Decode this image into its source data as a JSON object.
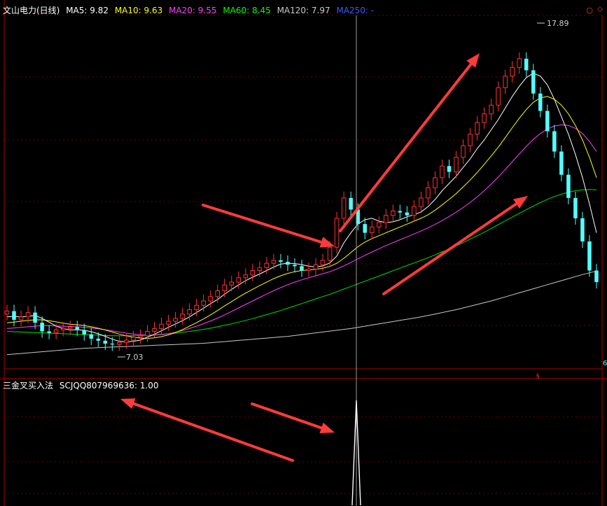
{
  "header": {
    "title": "文山电力(日线)",
    "ma_items": [
      {
        "label": "MA5: 9.82",
        "color": "#ffffff"
      },
      {
        "label": "MA10: 9.63",
        "color": "#ffff00"
      },
      {
        "label": "MA20: 9.55",
        "color": "#ff40ff"
      },
      {
        "label": "MA60: 8.45",
        "color": "#00ff00"
      },
      {
        "label": "MA120: 7.97",
        "color": "#c8c8c8"
      },
      {
        "label": "MA250: -",
        "color": "#3c5aff"
      }
    ],
    "close_symbol": "○",
    "diamond_symbol": "◇"
  },
  "indicator": {
    "title": "三金叉买入法",
    "value_text": "SCJQQ807969636: 1.00"
  },
  "annotations": {
    "high_label": "17.89",
    "low_label": "7.03",
    "edge_label": "6"
  },
  "colors": {
    "up": "#ff3232",
    "down": "#54ffff",
    "ma5": "#ffffff",
    "ma10": "#ffff00",
    "ma20": "#ff40ff",
    "ma60": "#00dd00",
    "ma120": "#c8c8c8",
    "axis": "#b00000",
    "arrow": "#ff3b3b"
  },
  "chart_data": [
    {
      "type": "candlestick",
      "y_range": [
        6.6,
        18.3
      ],
      "candles_open": [
        8.2,
        8.3,
        8.0,
        8.1,
        8.25,
        7.9,
        7.6,
        7.55,
        7.65,
        7.7,
        7.75,
        7.65,
        7.5,
        7.35,
        7.28,
        7.18,
        7.15,
        7.22,
        7.3,
        7.4,
        7.45,
        7.6,
        7.7,
        7.85,
        7.95,
        8.05,
        8.2,
        8.35,
        8.5,
        8.65,
        8.8,
        9.0,
        9.2,
        9.3,
        9.45,
        9.55,
        9.7,
        9.8,
        9.95,
        10.05,
        10.0,
        9.9,
        9.85,
        9.7,
        9.75,
        9.9,
        10.05,
        10.5,
        11.5,
        12.2,
        11.8,
        11.3,
        11.0,
        11.2,
        11.35,
        11.6,
        11.75,
        11.7,
        11.6,
        11.9,
        12.2,
        12.55,
        12.9,
        13.3,
        13.1,
        13.6,
        14.0,
        14.4,
        14.8,
        15.1,
        15.4,
        16.0,
        16.4,
        16.7,
        17.0,
        16.6,
        15.8,
        15.2,
        14.5,
        13.8,
        13.0,
        12.2,
        11.5,
        10.7,
        9.7
      ],
      "candles_close": [
        8.3,
        8.0,
        8.1,
        8.25,
        7.9,
        7.6,
        7.55,
        7.65,
        7.7,
        7.75,
        7.65,
        7.5,
        7.35,
        7.28,
        7.18,
        7.15,
        7.22,
        7.3,
        7.4,
        7.45,
        7.6,
        7.7,
        7.85,
        7.95,
        8.05,
        8.2,
        8.35,
        8.5,
        8.65,
        8.8,
        9.0,
        9.2,
        9.3,
        9.45,
        9.55,
        9.7,
        9.8,
        9.95,
        10.05,
        10.0,
        9.9,
        9.85,
        9.7,
        9.75,
        9.9,
        10.05,
        10.5,
        11.5,
        12.2,
        11.8,
        11.3,
        11.0,
        11.2,
        11.35,
        11.6,
        11.75,
        11.7,
        11.6,
        11.9,
        12.2,
        12.55,
        12.9,
        13.3,
        13.1,
        13.6,
        14.0,
        14.4,
        14.8,
        15.1,
        15.4,
        16.0,
        16.4,
        16.7,
        17.0,
        16.6,
        15.8,
        15.2,
        14.5,
        13.8,
        13.0,
        12.2,
        11.5,
        10.7,
        9.7,
        9.3
      ],
      "ma5": [
        8.1,
        8.12,
        8.1,
        8.12,
        8.15,
        8.05,
        7.92,
        7.78,
        7.7,
        7.65,
        7.66,
        7.64,
        7.59,
        7.52,
        7.43,
        7.33,
        7.26,
        7.24,
        7.26,
        7.3,
        7.4,
        7.5,
        7.62,
        7.74,
        7.86,
        7.97,
        8.1,
        8.25,
        8.4,
        8.56,
        8.7,
        8.88,
        9.05,
        9.2,
        9.35,
        9.47,
        9.58,
        9.7,
        9.82,
        9.92,
        9.95,
        9.94,
        9.9,
        9.85,
        9.82,
        9.86,
        9.96,
        10.2,
        10.65,
        11.0,
        11.3,
        11.45,
        11.5,
        11.4,
        11.35,
        11.38,
        11.45,
        11.55,
        11.62,
        11.72,
        11.9,
        12.15,
        12.45,
        12.7,
        12.95,
        13.25,
        13.55,
        13.9,
        14.2,
        14.55,
        14.9,
        15.3,
        15.7,
        16.05,
        16.35,
        16.5,
        16.4,
        16.1,
        15.6,
        15.0,
        14.4,
        13.7,
        12.9,
        12.0,
        11.0
      ],
      "ma10": [
        7.9,
        7.92,
        7.95,
        7.98,
        8.0,
        8.0,
        7.97,
        7.93,
        7.88,
        7.85,
        7.83,
        7.8,
        7.76,
        7.71,
        7.65,
        7.58,
        7.51,
        7.45,
        7.4,
        7.37,
        7.36,
        7.38,
        7.42,
        7.48,
        7.56,
        7.66,
        7.78,
        7.9,
        8.03,
        8.17,
        8.32,
        8.48,
        8.63,
        8.78,
        8.92,
        9.05,
        9.18,
        9.3,
        9.42,
        9.52,
        9.6,
        9.66,
        9.7,
        9.72,
        9.74,
        9.78,
        9.84,
        9.95,
        10.12,
        10.32,
        10.52,
        10.68,
        10.8,
        10.9,
        11.0,
        11.1,
        11.2,
        11.3,
        11.4,
        11.5,
        11.62,
        11.78,
        11.96,
        12.15,
        12.35,
        12.58,
        12.82,
        13.08,
        13.36,
        13.65,
        13.95,
        14.28,
        14.62,
        14.95,
        15.25,
        15.5,
        15.65,
        15.7,
        15.6,
        15.4,
        15.1,
        14.7,
        14.2,
        13.6,
        12.9
      ],
      "ma20": [
        7.7,
        7.72,
        7.74,
        7.76,
        7.78,
        7.8,
        7.8,
        7.79,
        7.78,
        7.77,
        7.76,
        7.74,
        7.72,
        7.69,
        7.66,
        7.62,
        7.58,
        7.54,
        7.51,
        7.49,
        7.47,
        7.47,
        7.49,
        7.52,
        7.57,
        7.63,
        7.7,
        7.78,
        7.87,
        7.96,
        8.06,
        8.17,
        8.29,
        8.41,
        8.53,
        8.65,
        8.77,
        8.89,
        9.0,
        9.11,
        9.21,
        9.3,
        9.38,
        9.45,
        9.52,
        9.59,
        9.66,
        9.75,
        9.86,
        9.98,
        10.1,
        10.22,
        10.34,
        10.45,
        10.56,
        10.66,
        10.76,
        10.86,
        10.96,
        11.06,
        11.17,
        11.29,
        11.42,
        11.56,
        11.71,
        11.87,
        12.05,
        12.24,
        12.45,
        12.68,
        12.92,
        13.18,
        13.45,
        13.72,
        13.98,
        14.22,
        14.42,
        14.58,
        14.68,
        14.72,
        14.7,
        14.6,
        14.42,
        14.15,
        13.8
      ],
      "ma60": [
        7.6,
        7.59,
        7.58,
        7.57,
        7.56,
        7.55,
        7.54,
        7.53,
        7.52,
        7.51,
        7.5,
        7.49,
        7.48,
        7.47,
        7.46,
        7.45,
        7.45,
        7.45,
        7.45,
        7.46,
        7.47,
        7.48,
        7.5,
        7.52,
        7.54,
        7.57,
        7.6,
        7.63,
        7.67,
        7.71,
        7.76,
        7.81,
        7.86,
        7.92,
        7.98,
        8.04,
        8.11,
        8.18,
        8.25,
        8.32,
        8.4,
        8.48,
        8.56,
        8.64,
        8.72,
        8.8,
        8.88,
        8.97,
        9.06,
        9.15,
        9.24,
        9.33,
        9.42,
        9.51,
        9.6,
        9.69,
        9.78,
        9.87,
        9.96,
        10.05,
        10.14,
        10.24,
        10.34,
        10.44,
        10.55,
        10.66,
        10.78,
        10.9,
        11.02,
        11.15,
        11.28,
        11.41,
        11.54,
        11.67,
        11.8,
        11.92,
        12.04,
        12.15,
        12.25,
        12.33,
        12.4,
        12.45,
        12.48,
        12.49,
        12.48
      ],
      "ma120": [
        6.8,
        6.82,
        6.84,
        6.86,
        6.88,
        6.9,
        6.92,
        6.94,
        6.96,
        6.98,
        7.0,
        7.02,
        7.03,
        7.04,
        7.05,
        7.06,
        7.07,
        7.08,
        7.09,
        7.1,
        7.11,
        7.12,
        7.13,
        7.14,
        7.15,
        7.16,
        7.17,
        7.18,
        7.19,
        7.21,
        7.23,
        7.25,
        7.27,
        7.29,
        7.31,
        7.33,
        7.35,
        7.37,
        7.39,
        7.41,
        7.43,
        7.46,
        7.49,
        7.52,
        7.55,
        7.58,
        7.61,
        7.64,
        7.67,
        7.7,
        7.74,
        7.78,
        7.82,
        7.86,
        7.9,
        7.94,
        7.98,
        8.02,
        8.06,
        8.1,
        8.15,
        8.2,
        8.25,
        8.3,
        8.35,
        8.41,
        8.47,
        8.53,
        8.59,
        8.65,
        8.72,
        8.79,
        8.86,
        8.93,
        9.0,
        9.07,
        9.14,
        9.21,
        9.28,
        9.35,
        9.42,
        9.49,
        9.56,
        9.62,
        9.68
      ]
    },
    {
      "type": "line",
      "series": [
        {
          "name": "SCJQQ807969636",
          "values": [
            0,
            1,
            0
          ]
        }
      ],
      "y_range": [
        0,
        1.0
      ]
    }
  ]
}
